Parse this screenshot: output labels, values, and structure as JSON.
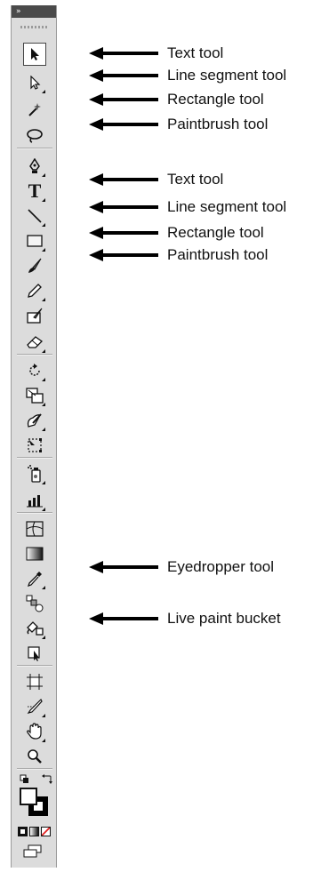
{
  "toolbar": {
    "collapse_glyph": "»",
    "tools": [
      {
        "id": "selection",
        "icon": "selection-arrow-icon"
      },
      {
        "id": "direct-selection",
        "icon": "direct-selection-icon"
      },
      {
        "id": "magic-wand",
        "icon": "magic-wand-icon"
      },
      {
        "id": "lasso",
        "icon": "lasso-icon"
      },
      {
        "id": "pen",
        "icon": "pen-icon"
      },
      {
        "id": "type",
        "icon": "type-icon",
        "glyph": "T"
      },
      {
        "id": "line-segment",
        "icon": "line-segment-icon"
      },
      {
        "id": "rectangle",
        "icon": "rectangle-icon"
      },
      {
        "id": "paintbrush",
        "icon": "paintbrush-icon"
      },
      {
        "id": "pencil",
        "icon": "pencil-icon"
      },
      {
        "id": "blob-brush",
        "icon": "blob-brush-icon"
      },
      {
        "id": "eraser",
        "icon": "eraser-icon"
      },
      {
        "id": "rotate",
        "icon": "rotate-icon"
      },
      {
        "id": "scale",
        "icon": "scale-icon"
      },
      {
        "id": "warp",
        "icon": "warp-icon"
      },
      {
        "id": "free-transform",
        "icon": "free-transform-icon"
      },
      {
        "id": "symbol-sprayer",
        "icon": "symbol-sprayer-icon"
      },
      {
        "id": "column-graph",
        "icon": "column-graph-icon"
      },
      {
        "id": "mesh",
        "icon": "mesh-icon"
      },
      {
        "id": "gradient",
        "icon": "gradient-icon"
      },
      {
        "id": "eyedropper",
        "icon": "eyedropper-icon"
      },
      {
        "id": "blend",
        "icon": "blend-icon"
      },
      {
        "id": "live-paint-bucket",
        "icon": "live-paint-bucket-icon"
      },
      {
        "id": "live-paint-selection",
        "icon": "live-paint-selection-icon"
      },
      {
        "id": "artboard",
        "icon": "artboard-icon"
      },
      {
        "id": "slice",
        "icon": "slice-icon"
      },
      {
        "id": "hand",
        "icon": "hand-icon"
      },
      {
        "id": "zoom",
        "icon": "zoom-icon"
      }
    ],
    "fill_color": "#ffffff",
    "stroke_color": "#000000",
    "none_swatch_color": "#e02020"
  },
  "annotations": [
    {
      "label": "Text tool"
    },
    {
      "label": "Line segment tool"
    },
    {
      "label": "Rectangle tool"
    },
    {
      "label": "Paintbrush tool"
    },
    {
      "label": "Text tool"
    },
    {
      "label": "Line segment tool"
    },
    {
      "label": "Rectangle tool"
    },
    {
      "label": "Paintbrush tool"
    },
    {
      "label": "Eyedropper tool"
    },
    {
      "label": "Live paint bucket"
    }
  ]
}
